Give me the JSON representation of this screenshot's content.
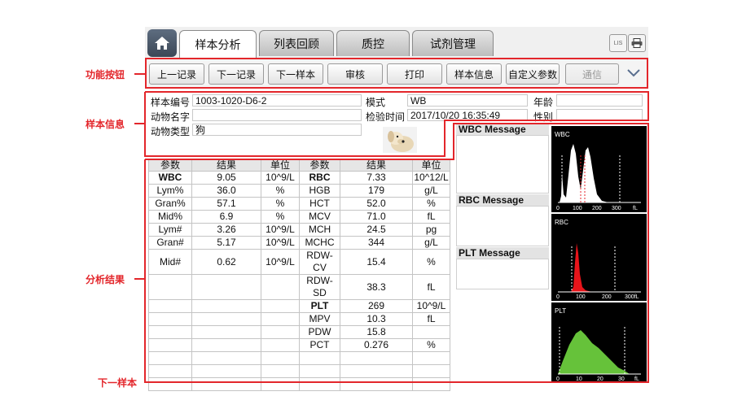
{
  "annotations": {
    "function_buttons": "功能按钮",
    "sample_info": "样本信息",
    "analysis_results": "分析结果",
    "next_sample": "下一样本"
  },
  "tabs": [
    {
      "label": "样本分析",
      "active": true
    },
    {
      "label": "列表回顾",
      "active": false
    },
    {
      "label": "质控",
      "active": false
    },
    {
      "label": "试剂管理",
      "active": false
    }
  ],
  "top_icons": {
    "lis_label": "LIS"
  },
  "toolbar": {
    "buttons": [
      {
        "label": "上一记录",
        "enabled": true
      },
      {
        "label": "下一记录",
        "enabled": true
      },
      {
        "label": "下一样本",
        "enabled": true
      },
      {
        "label": "审核",
        "enabled": true
      },
      {
        "label": "打印",
        "enabled": true
      },
      {
        "label": "样本信息",
        "enabled": true
      },
      {
        "label": "自定义参数",
        "enabled": true
      },
      {
        "label": "通信",
        "enabled": false
      }
    ]
  },
  "sample": {
    "id_label": "样本编号",
    "id_value": "1003-1020-D6-2",
    "animal_name_label": "动物名字",
    "animal_name_value": "",
    "animal_type_label": "动物类型",
    "animal_type_value": "狗",
    "mode_label": "模式",
    "mode_value": "WB",
    "test_time_label": "检验时间",
    "test_time_value": "2017/10/20 16:35:49",
    "age_label": "年龄",
    "age_value": "",
    "gender_label": "性别",
    "gender_value": ""
  },
  "results": {
    "headers": [
      "参数",
      "结果",
      "单位",
      "参数",
      "结果",
      "单位"
    ],
    "rows": [
      [
        "WBC",
        "9.05",
        "10^9/L",
        "RBC",
        "7.33",
        "10^12/L"
      ],
      [
        "Lym%",
        "36.0",
        "%",
        "HGB",
        "179",
        "g/L"
      ],
      [
        "Gran%",
        "57.1",
        "%",
        "HCT",
        "52.0",
        "%"
      ],
      [
        "Mid%",
        "6.9",
        "%",
        "MCV",
        "71.0",
        "fL"
      ],
      [
        "Lym#",
        "3.26",
        "10^9/L",
        "MCH",
        "24.5",
        "pg"
      ],
      [
        "Gran#",
        "5.17",
        "10^9/L",
        "MCHC",
        "344",
        "g/L"
      ],
      [
        "Mid#",
        "0.62",
        "10^9/L",
        "RDW-CV",
        "15.4",
        "%"
      ],
      [
        "",
        "",
        "",
        "RDW-SD",
        "38.3",
        "fL"
      ],
      [
        "",
        "",
        "",
        "PLT",
        "269",
        "10^9/L"
      ],
      [
        "",
        "",
        "",
        "MPV",
        "10.3",
        "fL"
      ],
      [
        "",
        "",
        "",
        "PDW",
        "15.8",
        ""
      ],
      [
        "",
        "",
        "",
        "PCT",
        "0.276",
        "%"
      ],
      [
        "",
        "",
        "",
        "",
        "",
        ""
      ],
      [
        "",
        "",
        "",
        "",
        "",
        ""
      ],
      [
        "",
        "",
        "",
        "",
        "",
        ""
      ]
    ],
    "bold_params": [
      "WBC",
      "RBC",
      "PLT"
    ]
  },
  "messages": {
    "wbc": "WBC Message",
    "rbc": "RBC Message",
    "plt": "PLT Message"
  },
  "histograms": {
    "wbc": {
      "title": "WBC",
      "ticks": [
        "0",
        "100",
        "200",
        "300",
        "fL"
      ],
      "color": "#ffffff"
    },
    "rbc": {
      "title": "RBC",
      "ticks": [
        "0",
        "100",
        "200",
        "300fL"
      ],
      "color": "#e8141a"
    },
    "plt": {
      "title": "PLT",
      "ticks": [
        "0",
        "10",
        "20",
        "30",
        "fL"
      ],
      "color": "#66c23a"
    }
  }
}
